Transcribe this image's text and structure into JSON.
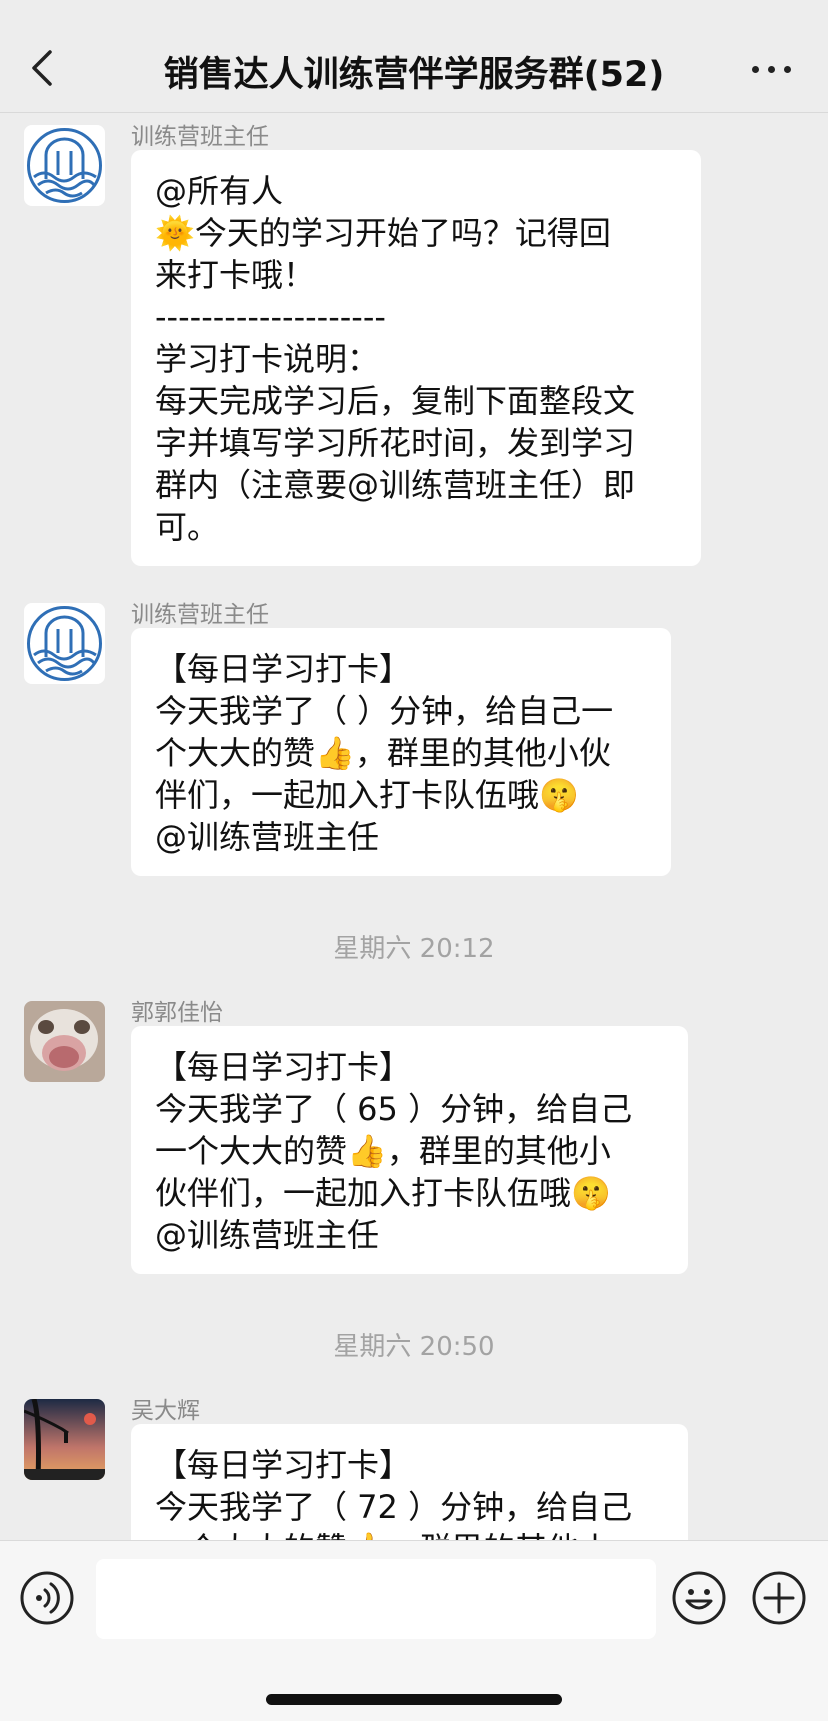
{
  "header": {
    "title": "销售达人训练营伴学服务群(52)",
    "back_icon": "chevron-left-icon",
    "more_icon": "more-dots-icon"
  },
  "messages": [
    {
      "sender": "训练营班主任",
      "avatar_icon": "camp-logo-avatar",
      "lines": [
        "@所有人",
        "🌞今天的学习开始了吗？记得回",
        "来打卡哦！",
        "--------------------",
        "学习打卡说明：",
        "每天完成学习后，复制下面整段文",
        "字并填写学习所花时间，发到学习",
        "群内（注意要@训练营班主任）即",
        "可。"
      ]
    },
    {
      "sender": "训练营班主任",
      "avatar_icon": "camp-logo-avatar",
      "lines": [
        "【每日学习打卡】",
        "今天我学了（ ）分钟，给自己一",
        "个大大的赞👍，群里的其他小伙",
        "伴们，一起加入打卡队伍哦🤫",
        "@训练营班主任"
      ]
    },
    {
      "timestamp": "星期六 20:12"
    },
    {
      "sender": "郭郭佳怡",
      "avatar_icon": "cat-photo-avatar",
      "lines": [
        "【每日学习打卡】",
        "今天我学了（ 65 ）分钟，给自己",
        "一个大大的赞👍，群里的其他小",
        "伙伴们，一起加入打卡队伍哦🤫",
        "@训练营班主任"
      ]
    },
    {
      "timestamp": "星期六 20:50"
    },
    {
      "sender": "吴大辉",
      "avatar_icon": "sunset-tree-avatar",
      "lines": [
        "【每日学习打卡】",
        "今天我学了（ 72 ）分钟，给自己",
        "一个大大的赞👍，群里的其他小"
      ]
    }
  ],
  "input_bar": {
    "voice_icon": "voice-icon",
    "emoji_icon": "emoji-icon",
    "plus_icon": "plus-icon",
    "text_value": ""
  },
  "colors": {
    "background": "#ededed",
    "bubble": "#ffffff",
    "avatar_logo_blue": "#2f6fb6"
  }
}
